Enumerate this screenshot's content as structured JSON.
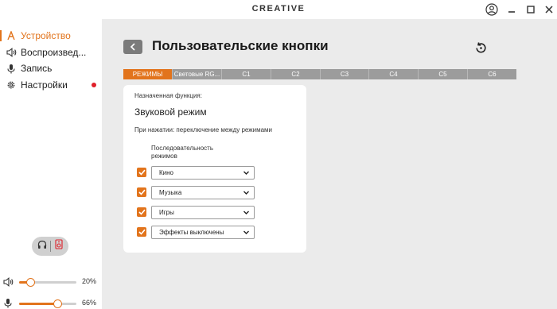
{
  "app": {
    "brand": "CREATIVE"
  },
  "sidebar": {
    "items": [
      {
        "label": "Устройство",
        "icon": "device-icon",
        "active": true
      },
      {
        "label": "Воспроизвед...",
        "icon": "speaker-icon",
        "active": false
      },
      {
        "label": "Запись",
        "icon": "microphone-icon",
        "active": false
      },
      {
        "label": "Настройки",
        "icon": "gear-icon",
        "active": false,
        "notification": true
      }
    ],
    "output_toggle": {
      "left_icon": "headphones-icon",
      "right_icon": "speaker-device-icon"
    },
    "volume": {
      "value": 0.2,
      "label": "20%"
    },
    "mic": {
      "value": 0.66,
      "label": "66%"
    }
  },
  "main": {
    "title": "Пользовательские кнопки",
    "tabs": [
      {
        "label": "РЕЖИМЫ",
        "active": true
      },
      {
        "label": "Световые RG...",
        "active": false
      },
      {
        "label": "C1",
        "active": false
      },
      {
        "label": "C2",
        "active": false
      },
      {
        "label": "C3",
        "active": false
      },
      {
        "label": "C4",
        "active": false
      },
      {
        "label": "C5",
        "active": false
      },
      {
        "label": "C6",
        "active": false
      }
    ],
    "panel": {
      "assigned_label": "Назначенная функция:",
      "function": "Звуковой режим",
      "description": "При нажатии: переключение между режимами",
      "sequence_label": "Последовательность режимов",
      "modes": [
        {
          "value": "Кино",
          "checked": true
        },
        {
          "value": "Музыка",
          "checked": true
        },
        {
          "value": "Игры",
          "checked": true
        },
        {
          "value": "Эффекты выключены",
          "checked": true
        }
      ]
    }
  },
  "colors": {
    "accent": "#e2741c",
    "notification": "#e0202a",
    "tab_bar": "#9c9c9c",
    "background": "#ebebeb"
  }
}
